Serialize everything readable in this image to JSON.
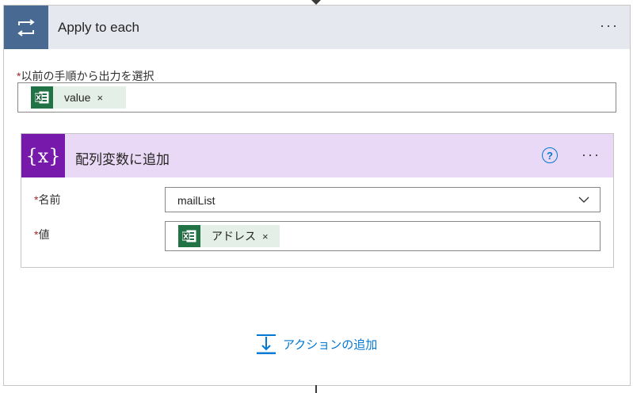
{
  "outer": {
    "title": "Apply to each",
    "more_label": "···",
    "select_label": "以前の手順から出力を選択",
    "required_mark": "*",
    "token": {
      "label": "value",
      "remove": "×",
      "icon": "excel-icon"
    }
  },
  "inner": {
    "title": "配列変数に追加",
    "help_label": "?",
    "more_label": "···",
    "icon_text": "{x}",
    "name_field": {
      "label": "名前",
      "required_mark": "*",
      "value": "mailList"
    },
    "value_field": {
      "label": "値",
      "required_mark": "*",
      "token": {
        "label": "アドレス",
        "remove": "×",
        "icon": "excel-icon"
      }
    }
  },
  "add_action": {
    "label": "アクションの追加"
  },
  "colors": {
    "loop_accent": "#486991",
    "variable_accent": "#7719aa",
    "variable_header": "#ead9f6",
    "excel_green": "#217346",
    "link_blue": "#0078d4"
  }
}
